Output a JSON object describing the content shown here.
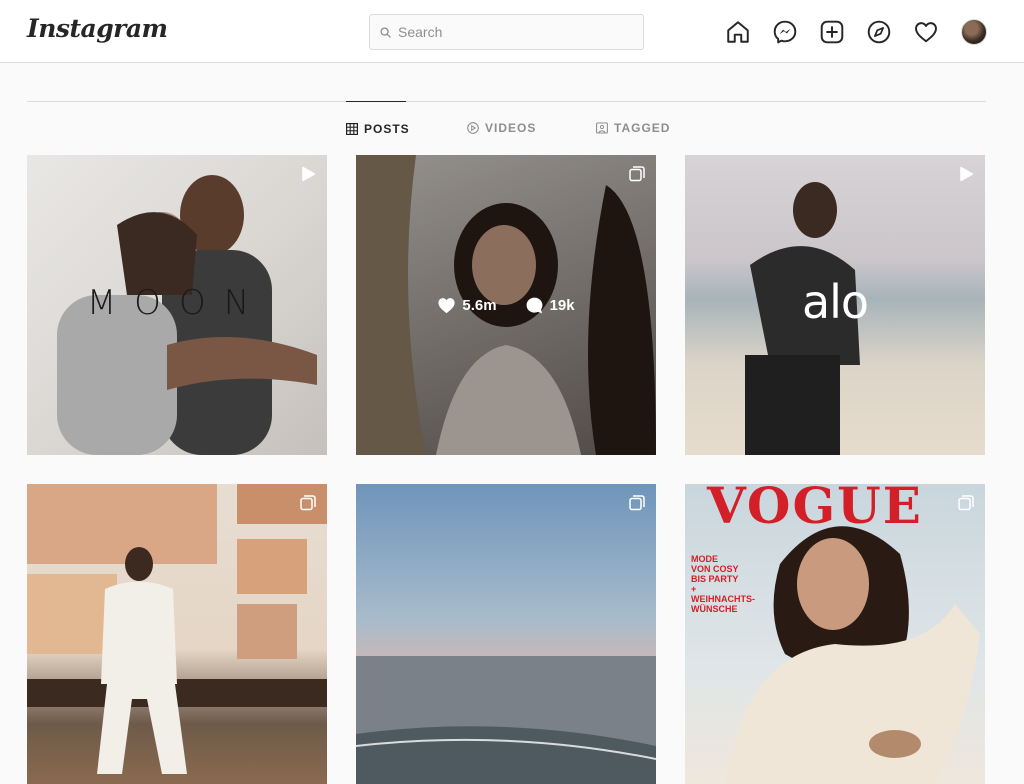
{
  "header": {
    "logo": "Instagram",
    "search_placeholder": "Search"
  },
  "nav_icons": [
    "home-icon",
    "messenger-icon",
    "new-post-icon",
    "explore-icon",
    "activity-heart-icon",
    "profile-avatar"
  ],
  "tabs": [
    {
      "label": "POSTS",
      "icon": "grid-icon",
      "active": true
    },
    {
      "label": "VIDEOS",
      "icon": "play-circle-icon",
      "active": false
    },
    {
      "label": "TAGGED",
      "icon": "tagged-icon",
      "active": false
    }
  ],
  "posts": [
    {
      "type": "video",
      "caption_text": "MOON",
      "badge_icon": "reel-play-icon"
    },
    {
      "type": "carousel",
      "likes": "5.6m",
      "comments": "19k",
      "badge_icon": "carousel-icon",
      "hovered": true
    },
    {
      "type": "video",
      "caption_text": "alo",
      "badge_icon": "reel-play-icon"
    },
    {
      "type": "carousel",
      "badge_icon": "carousel-icon"
    },
    {
      "type": "carousel",
      "badge_icon": "carousel-icon"
    },
    {
      "type": "carousel",
      "cover_title": "VOGUE",
      "cover_text": "MODE\nVON COSY\nBIS PARTY\n+\nWEIHNACHTS-\nWÜNSCHE",
      "badge_icon": "carousel-icon"
    }
  ],
  "colors": {
    "background": "#fafafa",
    "border": "#dbdbdb",
    "text": "#262626",
    "muted": "#8e8e8e",
    "vogue_red": "#d31f28"
  }
}
